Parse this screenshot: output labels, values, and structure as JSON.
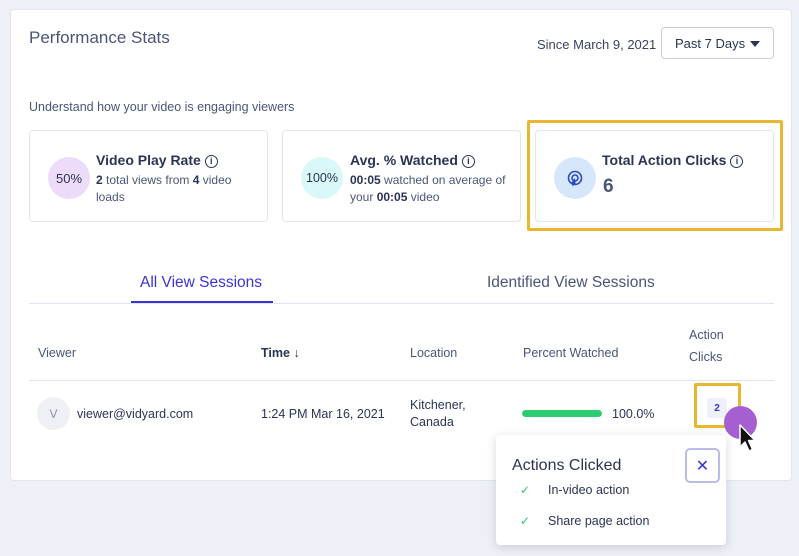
{
  "header": {
    "title": "Performance Stats",
    "since": "Since March 9, 2021",
    "range_select": "Past 7 Days",
    "subtitle": "Understand how your video is engaging viewers"
  },
  "stats": [
    {
      "badge": "50%",
      "title": "Video Play Rate",
      "desc_parts": [
        "2",
        " total views from ",
        "4",
        " video loads"
      ],
      "badge_color": "#ecdcfa"
    },
    {
      "badge": "100%",
      "title": "Avg. % Watched",
      "desc_parts": [
        "00:05",
        " watched on average of your ",
        "00:05",
        " video"
      ],
      "badge_color": "#d9f8f8"
    },
    {
      "title": "Total Action Clicks",
      "value": "6",
      "badge_color": "#d7e7fb",
      "icon": "cursor-click-icon"
    }
  ],
  "tabs": [
    {
      "label": "All View Sessions",
      "active": true
    },
    {
      "label": "Identified View Sessions",
      "active": false
    }
  ],
  "table": {
    "columns": [
      "Viewer",
      "Time",
      "Location",
      "Percent Watched",
      "Action",
      "Clicks"
    ],
    "rows": [
      {
        "avatar": "V",
        "viewer": "viewer@vidyard.com",
        "time": "1:24 PM Mar 16, 2021",
        "location_line1": "Kitchener,",
        "location_line2": "Canada",
        "percent": "100.0%",
        "percent_value": 1.0,
        "clicks": "2"
      }
    ]
  },
  "popup": {
    "title": "Actions Clicked",
    "items": [
      "In-video action",
      "Share page action"
    ]
  },
  "colors": {
    "accent": "#3b33d6",
    "highlight": "#e8b730",
    "progress": "#2ecc71"
  }
}
